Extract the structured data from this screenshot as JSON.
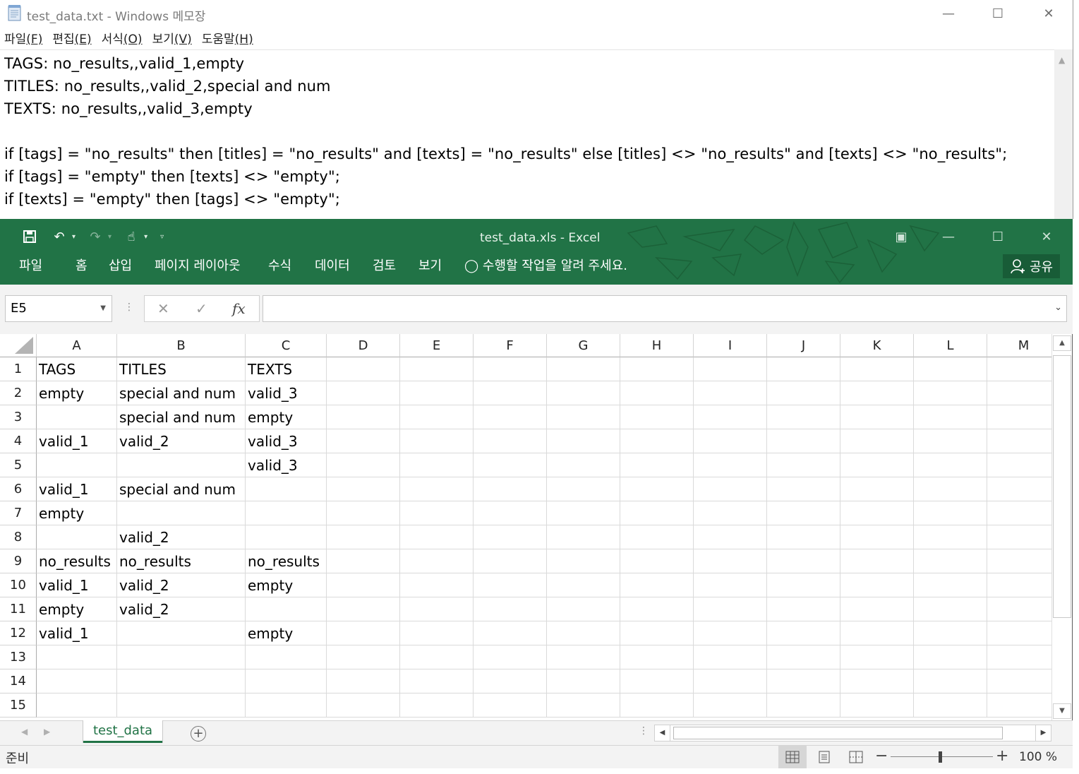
{
  "notepad": {
    "title": "test_data.txt - Windows 메모장",
    "menu": [
      {
        "label": "파일",
        "key": "(F)"
      },
      {
        "label": "편집",
        "key": "(E)"
      },
      {
        "label": "서식",
        "key": "(O)"
      },
      {
        "label": "보기",
        "key": "(V)"
      },
      {
        "label": "도움말",
        "key": "(H)"
      }
    ],
    "lines": [
      "TAGS: no_results,,valid_1,empty",
      "TITLES: no_results,,valid_2,special and num",
      "TEXTS: no_results,,valid_3,empty",
      "",
      "if [tags] = \"no_results\" then [titles] = \"no_results\" and [texts] = \"no_results\" else [titles] <> \"no_results\" and [texts] <> \"no_results\";",
      "if [tags] = \"empty\" then [texts] <> \"empty\";",
      "if [texts] = \"empty\" then [tags] <> \"empty\";"
    ]
  },
  "excel": {
    "title": "test_data.xls  -  Excel",
    "tabs": [
      "파일",
      "홈",
      "삽입",
      "페이지 레이아웃",
      "수식",
      "데이터",
      "검토",
      "보기"
    ],
    "tell_me": "수행할 작업을 알려 주세요.",
    "share_label": "공유",
    "name_box": "E5",
    "formula": "",
    "fx_label": "fx",
    "columns": [
      "A",
      "B",
      "C",
      "D",
      "E",
      "F",
      "G",
      "H",
      "I",
      "J",
      "K",
      "L",
      "M"
    ],
    "rows": [
      [
        "TAGS",
        "TITLES",
        "TEXTS"
      ],
      [
        "empty",
        "special and num",
        "valid_3"
      ],
      [
        "",
        "special and num",
        "empty"
      ],
      [
        "valid_1",
        "valid_2",
        "valid_3"
      ],
      [
        "",
        "",
        "valid_3"
      ],
      [
        "valid_1",
        "special and num",
        ""
      ],
      [
        "empty",
        "",
        ""
      ],
      [
        "",
        "valid_2",
        ""
      ],
      [
        "no_results",
        "no_results",
        "no_results"
      ],
      [
        "valid_1",
        "valid_2",
        "empty"
      ],
      [
        "empty",
        "valid_2",
        ""
      ],
      [
        "valid_1",
        "",
        "empty"
      ],
      [
        "",
        "",
        ""
      ],
      [
        "",
        "",
        ""
      ],
      [
        "",
        "",
        ""
      ]
    ],
    "row_numbers": [
      "1",
      "2",
      "3",
      "4",
      "5",
      "6",
      "7",
      "8",
      "9",
      "10",
      "11",
      "12",
      "13",
      "14",
      "15"
    ],
    "sheet_tab": "test_data",
    "status": "준비",
    "zoom": "100 %",
    "accent": "#217346"
  }
}
